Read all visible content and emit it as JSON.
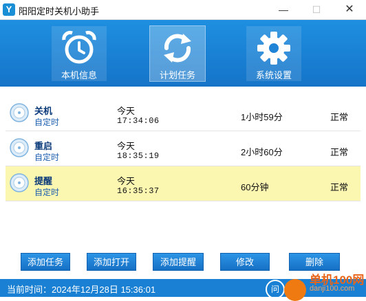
{
  "window": {
    "logo": "Y",
    "title": "阳阳定时关机小助手",
    "minimize": "—",
    "maximize": "☐",
    "close": "✕"
  },
  "nav": {
    "tiles": [
      {
        "label": "本机信息",
        "icon": "alarm-clock-icon",
        "active": false
      },
      {
        "label": "计划任务",
        "icon": "refresh-icon",
        "active": true
      },
      {
        "label": "系统设置",
        "icon": "gear-icon",
        "active": false
      }
    ]
  },
  "tasks": [
    {
      "name": "关机",
      "type": "自定时",
      "day": "今天",
      "time": "17:34:06",
      "remaining": "1小时59分",
      "status": "正常",
      "highlighted": false
    },
    {
      "name": "重启",
      "type": "自定时",
      "day": "今天",
      "time": "18:35:19",
      "remaining": "2小时60分",
      "status": "正常",
      "highlighted": false
    },
    {
      "name": "提醒",
      "type": "自定时",
      "day": "今天",
      "time": "16:35:37",
      "remaining": "60分钟",
      "status": "正常",
      "highlighted": true
    }
  ],
  "buttons": {
    "add_task": "添加任务",
    "add_open": "添加打开",
    "add_reminder": "添加提醒",
    "edit": "修改",
    "delete": "删除"
  },
  "statusbar": {
    "current_time": "当前时间：2024年12月28日 15:36:01"
  },
  "watermark": {
    "circle_text": "问",
    "site_name": "单机100网",
    "site_url": "danji100.com"
  },
  "colors": {
    "header_blue": "#1f8fe0",
    "button_blue": "#1670c4",
    "highlight_yellow": "#fbf7b0",
    "status_blue": "#1a80d3"
  }
}
